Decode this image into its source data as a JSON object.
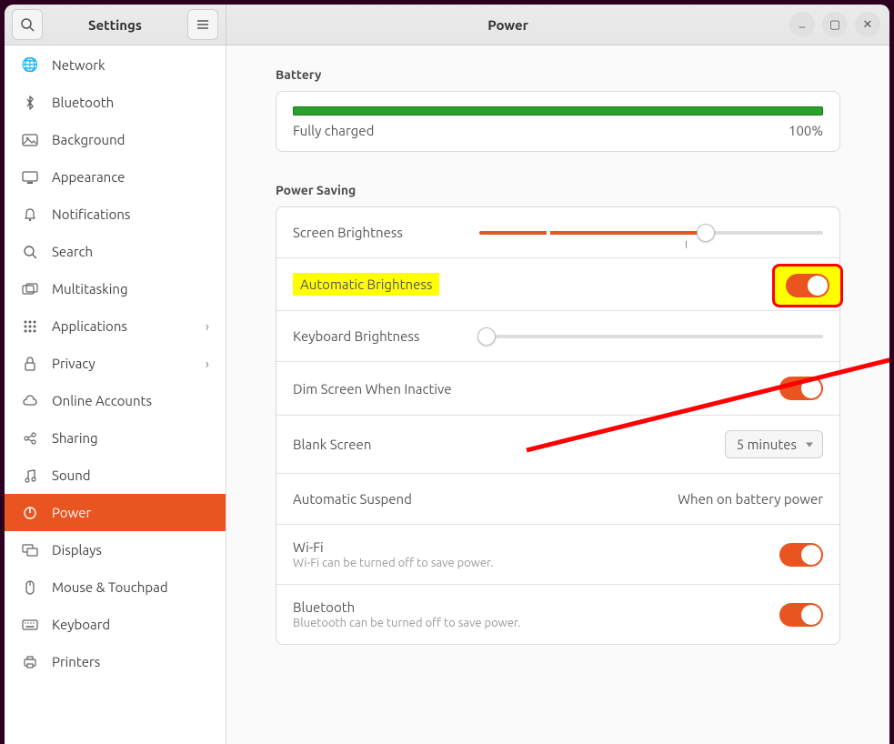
{
  "header": {
    "app_title": "Settings",
    "page_title": "Power"
  },
  "sidebar": {
    "items": [
      {
        "label": "Network"
      },
      {
        "label": "Bluetooth"
      },
      {
        "label": "Background"
      },
      {
        "label": "Appearance"
      },
      {
        "label": "Notifications"
      },
      {
        "label": "Search"
      },
      {
        "label": "Multitasking"
      },
      {
        "label": "Applications",
        "expand": true
      },
      {
        "label": "Privacy",
        "expand": true
      },
      {
        "label": "Online Accounts"
      },
      {
        "label": "Sharing"
      },
      {
        "label": "Sound"
      },
      {
        "label": "Power",
        "active": true
      },
      {
        "label": "Displays"
      },
      {
        "label": "Mouse & Touchpad"
      },
      {
        "label": "Keyboard"
      },
      {
        "label": "Printers"
      }
    ]
  },
  "battery": {
    "section": "Battery",
    "status": "Fully charged",
    "percent": "100%"
  },
  "power_saving": {
    "section": "Power Saving",
    "screen_brightness": {
      "label": "Screen Brightness",
      "value_pct": 66
    },
    "auto_brightness": {
      "label": "Automatic Brightness",
      "on": true
    },
    "keyboard_brightness": {
      "label": "Keyboard Brightness",
      "value_pct": 0
    },
    "dim_inactive": {
      "label": "Dim Screen When Inactive",
      "on": true
    },
    "blank_screen": {
      "label": "Blank Screen",
      "value": "5 minutes"
    },
    "auto_suspend": {
      "label": "Automatic Suspend",
      "value": "When on battery power"
    },
    "wifi": {
      "label": "Wi-Fi",
      "sub": "Wi-Fi can be turned off to save power.",
      "on": true
    },
    "bluetooth": {
      "label": "Bluetooth",
      "sub": "Bluetooth can be turned off to save power.",
      "on": true
    }
  }
}
